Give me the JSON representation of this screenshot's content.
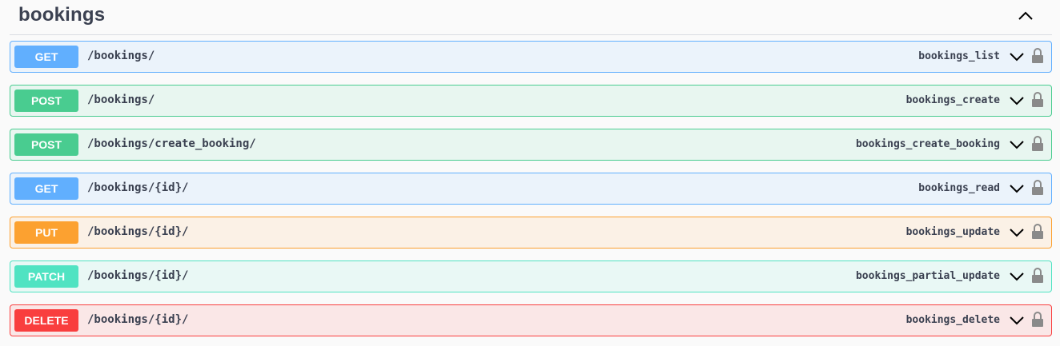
{
  "section": {
    "title": "bookings",
    "collapse_icon": "chevron-up-icon"
  },
  "operations": [
    {
      "method": "GET",
      "path": "/bookings/",
      "operation_id": "bookings_list",
      "color": "#61affe"
    },
    {
      "method": "POST",
      "path": "/bookings/",
      "operation_id": "bookings_create",
      "color": "#49cc90"
    },
    {
      "method": "POST",
      "path": "/bookings/create_booking/",
      "operation_id": "bookings_create_booking",
      "color": "#49cc90"
    },
    {
      "method": "GET",
      "path": "/bookings/{id}/",
      "operation_id": "bookings_read",
      "color": "#61affe"
    },
    {
      "method": "PUT",
      "path": "/bookings/{id}/",
      "operation_id": "bookings_update",
      "color": "#fca130"
    },
    {
      "method": "PATCH",
      "path": "/bookings/{id}/",
      "operation_id": "bookings_partial_update",
      "color": "#50e3c2"
    },
    {
      "method": "DELETE",
      "path": "/bookings/{id}/",
      "operation_id": "bookings_delete",
      "color": "#f93e3e"
    }
  ],
  "icons": {
    "expand": "chevron-down-icon",
    "auth": "lock-icon"
  }
}
